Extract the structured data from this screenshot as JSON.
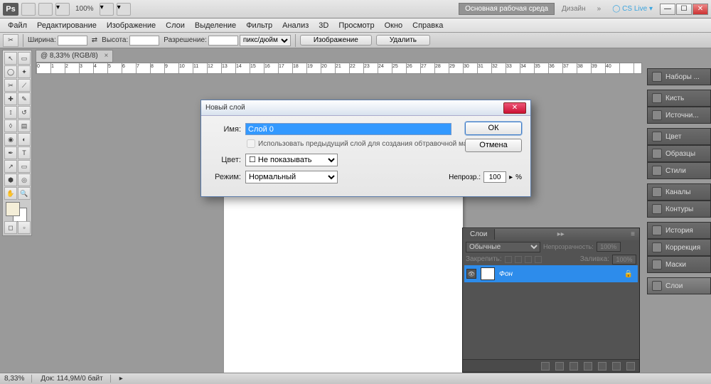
{
  "app": {
    "logo": "Ps",
    "zoom": "100%",
    "cslive": "CS Live"
  },
  "workspace": {
    "main": "Основная рабочая среда",
    "design": "Дизайн",
    "more": "»"
  },
  "menu": [
    "Файл",
    "Редактирование",
    "Изображение",
    "Слои",
    "Выделение",
    "Фильтр",
    "Анализ",
    "3D",
    "Просмотр",
    "Окно",
    "Справка"
  ],
  "optbar": {
    "width_lbl": "Ширина:",
    "height_lbl": "Высота:",
    "res_lbl": "Разрешение:",
    "unit": "пикс/дюйм",
    "btn_image": "Изображение",
    "btn_delete": "Удалить"
  },
  "doctab": {
    "title": "@ 8,33% (RGB/8)",
    "close": "×"
  },
  "rightpanels": [
    "Наборы ...",
    "Кисть",
    "Источни...",
    "Цвет",
    "Образцы",
    "Стили",
    "Каналы",
    "Контуры",
    "История",
    "Коррекция",
    "Маски",
    "Слои"
  ],
  "layers_panel": {
    "tab": "Слои",
    "mode": "Обычные",
    "opacity_lbl": "Непрозрачность:",
    "opacity": "100%",
    "lock_lbl": "Закрепить:",
    "fill_lbl": "Заливка:",
    "fill": "100%",
    "layer_name": "Фон"
  },
  "dialog": {
    "title": "Новый слой",
    "name_lbl": "Имя:",
    "name_val": "Слой 0",
    "checkbox": "Использовать предыдущий слой для создания обтравочной маски",
    "color_lbl": "Цвет:",
    "color_val": "Не показывать",
    "mode_lbl": "Режим:",
    "mode_val": "Нормальный",
    "opacity_lbl": "Непрозр.:",
    "opacity_val": "100",
    "opacity_suffix": "%",
    "ok": "ОК",
    "cancel": "Отмена"
  },
  "status": {
    "zoom": "8,33%",
    "doc": "Док: 114,9M/0 байт"
  }
}
